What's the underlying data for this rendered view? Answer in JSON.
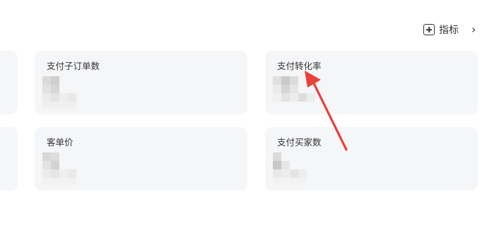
{
  "toolbar": {
    "add_metric_label": "指标"
  },
  "cards": [
    {
      "title": "支付子订单数"
    },
    {
      "title": "支付转化率"
    },
    {
      "title": "客单价"
    },
    {
      "title": "支付买家数"
    }
  ],
  "colors": {
    "card_bg": "#f5f6f8",
    "annotation_arrow": "#e8423a"
  }
}
